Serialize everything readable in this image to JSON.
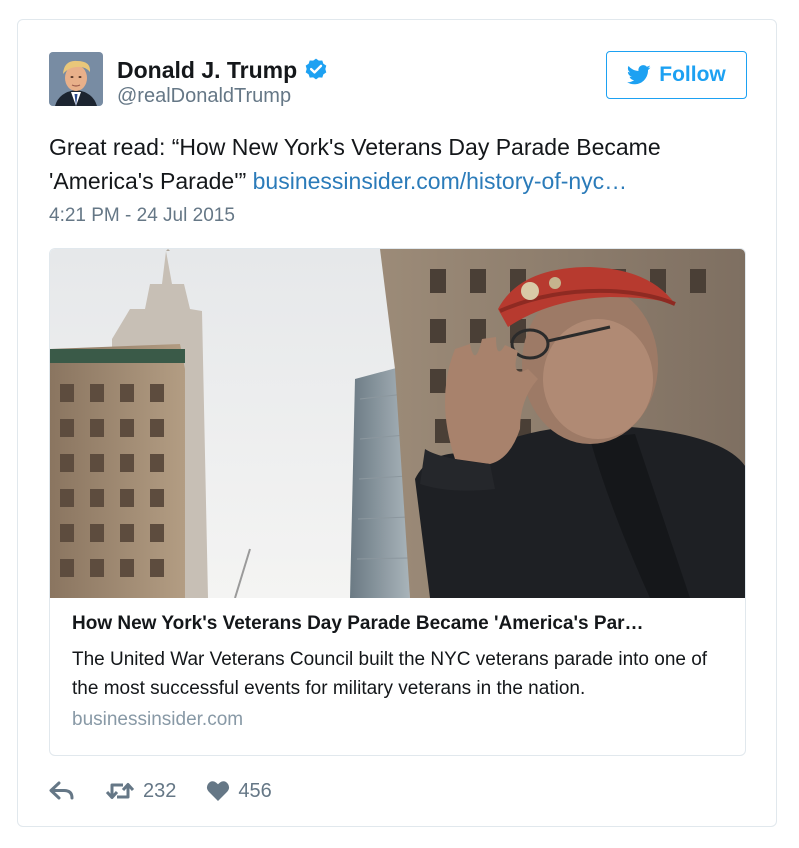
{
  "author": {
    "display_name": "Donald J. Trump",
    "handle": "@realDonaldTrump",
    "verified": true
  },
  "follow_button": {
    "label": "Follow"
  },
  "tweet": {
    "text_prefix": "Great read: “How New York's Veterans Day Parade Became 'America's Parade'”",
    "link_text": "businessinsider.com/history-of-nyc…",
    "timestamp": "4:21 PM - 24 Jul 2015"
  },
  "link_card": {
    "title": "How New York's Veterans Day Parade Became 'America's Par…",
    "description": "The United War Veterans Council built the NYC veterans parade into one of the most successful events for military veterans in the nation.",
    "domain": "businessinsider.com"
  },
  "actions": {
    "retweet_count": "232",
    "like_count": "456"
  },
  "colors": {
    "accent": "#1da1f2",
    "link": "#2b7bb9",
    "muted": "#657786"
  }
}
